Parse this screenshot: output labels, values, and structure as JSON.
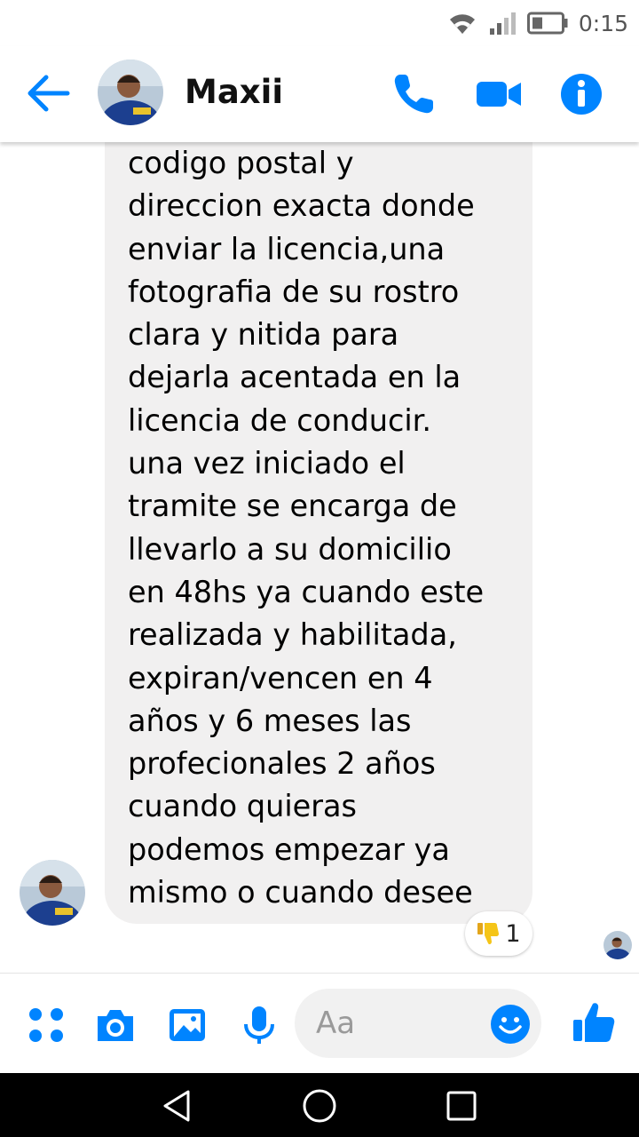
{
  "status_bar": {
    "time": "0:15"
  },
  "header": {
    "contact_name": "Maxii"
  },
  "message": {
    "text": "codigo postal y\ndireccion exacta donde\nenviar la licencia,una\nfotografia de su rostro\nclara y nitida para\ndejarla acentada en la\nlicencia de conducir.\nuna vez iniciado el\ntramite se encarga de\nllevarlo a su domicilio\nen 48hs ya cuando este\nrealizada y habilitada,\nexpiran/vencen en 4\naños y 6 meses las\nprofecionales 2 años\ncuando quieras\npodemos empezar ya\nmismo o cuando desee",
    "reaction_emoji": "thumbs-down",
    "reaction_count": "1"
  },
  "composer": {
    "placeholder": "Aa"
  },
  "colors": {
    "accent": "#0084ff",
    "bubble": "#f1f0f0",
    "reaction": "#f5c518"
  }
}
